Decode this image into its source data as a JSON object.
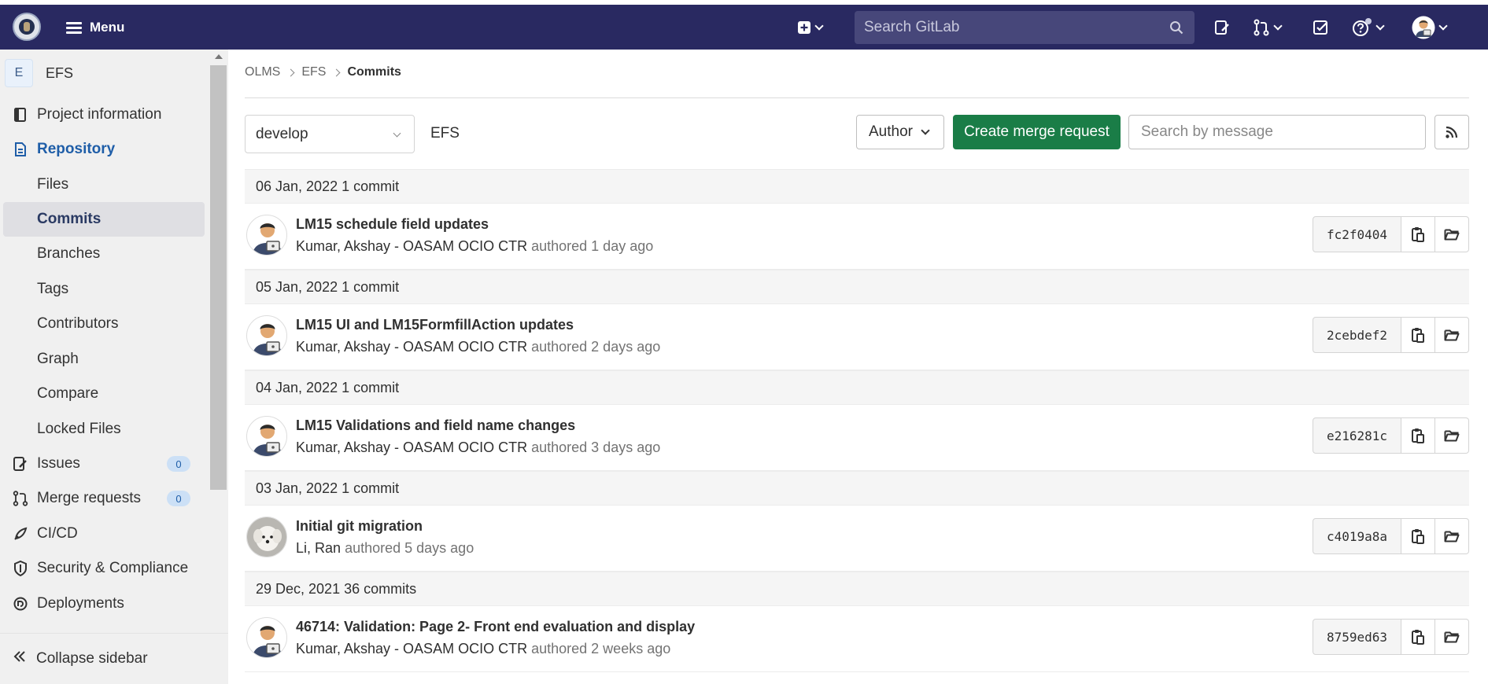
{
  "topbar": {
    "menu_label": "Menu",
    "search_placeholder": "Search GitLab"
  },
  "sidebar": {
    "project_initial": "E",
    "project_name": "EFS",
    "items": [
      {
        "label": "Project information",
        "icon": "book-icon"
      },
      {
        "label": "Repository",
        "icon": "document-icon"
      },
      {
        "label": "Files"
      },
      {
        "label": "Commits"
      },
      {
        "label": "Branches"
      },
      {
        "label": "Tags"
      },
      {
        "label": "Contributors"
      },
      {
        "label": "Graph"
      },
      {
        "label": "Compare"
      },
      {
        "label": "Locked Files"
      },
      {
        "label": "Issues",
        "icon": "issues-icon",
        "badge": "0"
      },
      {
        "label": "Merge requests",
        "icon": "merge-request-icon",
        "badge": "0"
      },
      {
        "label": "CI/CD",
        "icon": "rocket-icon"
      },
      {
        "label": "Security & Compliance",
        "icon": "shield-icon"
      },
      {
        "label": "Deployments",
        "icon": "deployments-icon"
      }
    ],
    "collapse_label": "Collapse sidebar"
  },
  "breadcrumb": [
    "OLMS",
    "EFS",
    "Commits"
  ],
  "toolbar": {
    "branch": "develop",
    "path": "EFS",
    "author_label": "Author",
    "create_mr_label": "Create merge request",
    "search_placeholder": "Search by message"
  },
  "days": [
    {
      "date": "06 Jan, 2022",
      "count": "1 commit"
    },
    {
      "date": "05 Jan, 2022",
      "count": "1 commit"
    },
    {
      "date": "04 Jan, 2022",
      "count": "1 commit"
    },
    {
      "date": "03 Jan, 2022",
      "count": "1 commit"
    },
    {
      "date": "29 Dec, 2021",
      "count": "36 commits"
    }
  ],
  "commits": [
    {
      "title": "LM15 schedule field updates",
      "author": "Kumar, Akshay - OASAM OCIO CTR",
      "authored": "authored",
      "when": "1 day ago",
      "sha": "fc2f0404"
    },
    {
      "title": "LM15 UI and LM15FormfillAction updates",
      "author": "Kumar, Akshay - OASAM OCIO CTR",
      "authored": "authored",
      "when": "2 days ago",
      "sha": "2cebdef2"
    },
    {
      "title": "LM15 Validations and field name changes",
      "author": "Kumar, Akshay - OASAM OCIO CTR",
      "authored": "authored",
      "when": "3 days ago",
      "sha": "e216281c"
    },
    {
      "title": "Initial git migration",
      "author": "Li, Ran",
      "authored": "authored",
      "when": "5 days ago",
      "sha": "c4019a8a"
    },
    {
      "title": "46714: Validation: Page 2- Front end evaluation and display",
      "author": "Kumar, Akshay - OASAM OCIO CTR",
      "authored": "authored",
      "when": "2 weeks ago",
      "sha": "8759ed63"
    }
  ]
}
